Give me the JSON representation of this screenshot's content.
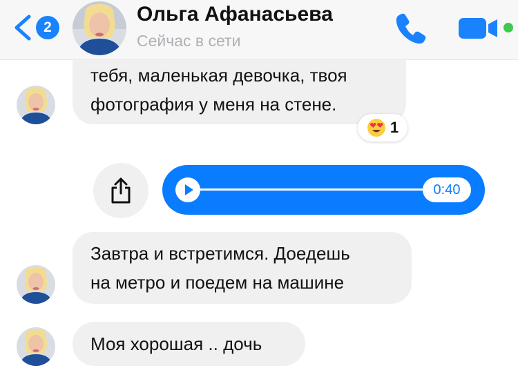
{
  "header": {
    "back_badge": "2",
    "contact_name": "Ольга Афанасьева",
    "status": "Сейчас в сети"
  },
  "messages": [
    {
      "type": "text",
      "direction": "incoming",
      "lines": [
        "тебя, маленькая девочка, твоя",
        "фотография у меня на стене."
      ],
      "reaction": {
        "emoji": "smiling-face-with-heart-eyes",
        "count": "1"
      }
    },
    {
      "type": "audio",
      "direction": "outgoing",
      "duration": "0:40",
      "progress": 0
    },
    {
      "type": "text",
      "direction": "incoming",
      "lines": [
        "Завтра и встретимся. Доедешь",
        "на метро и поедем на машине"
      ]
    },
    {
      "type": "text",
      "direction": "incoming",
      "lines": [
        "Моя хорошая .. дочь"
      ]
    }
  ],
  "colors": {
    "accent": "#0a7cff",
    "badge": "#1982fc",
    "incoming_bubble": "#f1f0f0",
    "status_text": "#b0b0b5",
    "online": "#3ccb4c"
  },
  "icons": {
    "back": "chevron-left-icon",
    "phone": "phone-icon",
    "video": "video-camera-icon",
    "share": "share-icon",
    "play": "play-icon"
  }
}
